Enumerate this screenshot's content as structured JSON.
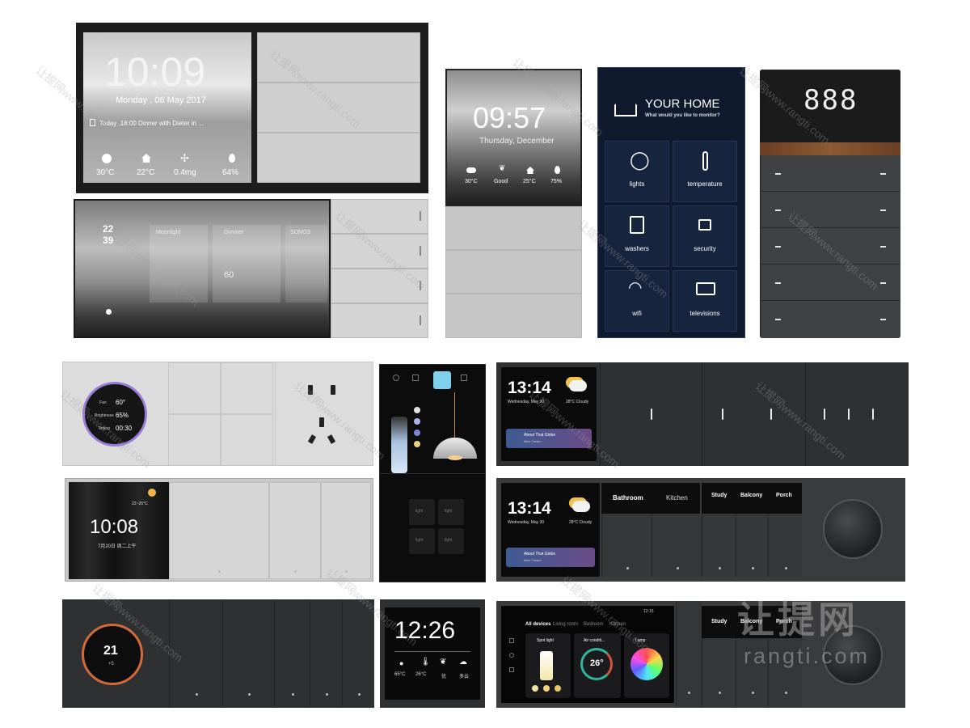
{
  "panel_a": {
    "time": "10:09",
    "date": "Monday , 06 May 2017",
    "event": "Today ,18:00  Dinner with Dieter in ...",
    "stats": [
      {
        "icon": "sun-icon",
        "value": "30°C"
      },
      {
        "icon": "home-icon",
        "value": "22°C"
      },
      {
        "icon": "fan-icon",
        "value": "0.4mg"
      },
      {
        "icon": "drop-icon",
        "value": "64%"
      }
    ]
  },
  "panel_b": {
    "clock_hour": "22",
    "clock_min": "39",
    "tabs": [
      "Moonlight",
      "Dimmer",
      "SONOS"
    ],
    "level": "60"
  },
  "panel_c": {
    "time": "09:57",
    "date": "Thursday, December",
    "stats": [
      "30°C",
      "Good",
      "25°C",
      "75%"
    ]
  },
  "panel_d": {
    "title": "YOUR HOME",
    "subtitle": "What would you like to monitor?",
    "tiles": [
      {
        "label": "lights",
        "icon": "bulb-icon"
      },
      {
        "label": "temperature",
        "icon": "thermometer-icon"
      },
      {
        "label": "washers",
        "icon": "washer-icon"
      },
      {
        "label": "security",
        "icon": "lock-icon"
      },
      {
        "label": "wifi",
        "icon": "wifi-icon"
      },
      {
        "label": "televisions",
        "icon": "tv-icon"
      }
    ]
  },
  "panel_e": {
    "display": "888"
  },
  "panel_f": {
    "rows": [
      {
        "label": "Fan",
        "value": "60°"
      },
      {
        "label": "Brightness",
        "value": "65%"
      },
      {
        "label": "Timing",
        "value": "00:30"
      }
    ]
  },
  "panel_h": {
    "time": "13:14",
    "date": "Wednesday, May 30",
    "weather": "28°C  Cloudy",
    "song": "About That Globe",
    "artist": "Mike Trasko"
  },
  "panel_i": {
    "time": "10:08",
    "temp": "22~26°C",
    "date": "7月20日  周二上午"
  },
  "panel_j": {
    "keys": [
      "light",
      "light",
      "light",
      "light"
    ]
  },
  "panel_k": {
    "time": "13:14",
    "date": "Wednesday, May 30",
    "weather": "28°C  Cloudy",
    "song": "About That Globe",
    "artist": "Mike Trasko",
    "labels": [
      "Bathroom",
      "Kitchen",
      "Study",
      "Balcony",
      "Porch"
    ]
  },
  "panel_l": {
    "temp": "21",
    "sub": "+5"
  },
  "panel_m": {
    "time": "12:26",
    "stats": [
      "65°C",
      "26°C",
      "优",
      "多云"
    ]
  },
  "panel_n": {
    "clock": "12:15",
    "tabs": [
      "All devices",
      "Living room",
      "Bedroom",
      "Kitchen"
    ],
    "cards": [
      "Spot light",
      "Air conditi...",
      "Lamp"
    ],
    "temp": "26°",
    "labels": [
      "Study",
      "Balcony",
      "Porch"
    ]
  },
  "watermark": {
    "line": "让提网www.rangti.com",
    "logo_cn": "让提网",
    "logo_en": "rangti.com"
  }
}
